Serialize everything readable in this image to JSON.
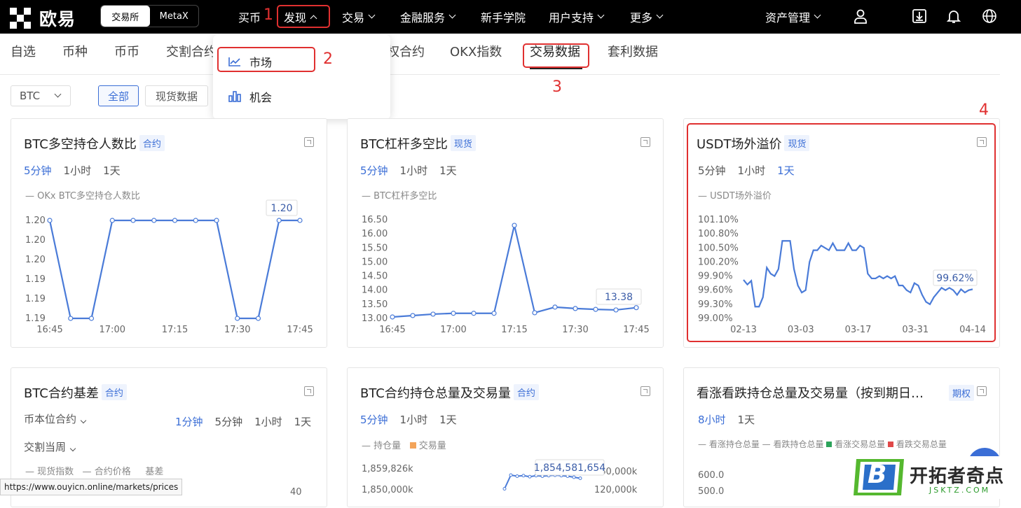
{
  "topbar": {
    "logo_text": "欧易",
    "seg": [
      "交易所",
      "MetaX"
    ],
    "nav": [
      "买币",
      "发现",
      "交易",
      "金融服务",
      "新手学院",
      "用户支持",
      "更多"
    ],
    "asset_mgmt": "资产管理"
  },
  "annotations": [
    "1",
    "2",
    "3",
    "4"
  ],
  "subnav": [
    "自选",
    "币种",
    "币币",
    "交割合约",
    "权合约",
    "OKX指数",
    "交易数据",
    "套利数据"
  ],
  "dropdown": {
    "items": [
      "市场",
      "机会"
    ]
  },
  "filter": {
    "coin": "BTC",
    "all": "全部",
    "spot": "现货数据"
  },
  "cards": [
    {
      "title": "BTC多空持仓人数比",
      "tag": "合约",
      "tabs": [
        "5分钟",
        "1小时",
        "1天"
      ],
      "legend": "OKx BTC多空持仓人数比"
    },
    {
      "title": "BTC杠杆多空比",
      "tag": "现货",
      "tabs": [
        "5分钟",
        "1小时",
        "1天"
      ],
      "legend": "BTC杠杆多空比"
    },
    {
      "title": "USDT场外溢价",
      "tag": "现货",
      "tabs": [
        "5分钟",
        "1小时",
        "1天"
      ],
      "legend": "USDT场外溢价"
    },
    {
      "title": "BTC合约基差",
      "tag": "合约",
      "selects": [
        "币本位合约",
        "交割当周"
      ],
      "tabs": [
        "1分钟",
        "5分钟",
        "1小时",
        "1天"
      ],
      "legend": [
        "现货指数",
        "合约价格",
        "基差"
      ],
      "axis_value": "40"
    },
    {
      "title": "BTC合约持仓总量及交易量",
      "tag": "合约",
      "tabs": [
        "5分钟",
        "1小时",
        "1天"
      ],
      "legend": [
        "持仓量",
        "交易量"
      ]
    },
    {
      "title": "看涨看跌持仓总量及交易量（按到期日…",
      "tag": "期权",
      "tabs": [
        "8小时",
        "1天"
      ],
      "legend": [
        "看涨持仓总量",
        "看跌持仓总量",
        "看涨交易总量",
        "看跌交易总量"
      ]
    }
  ],
  "chart_data": [
    {
      "type": "line",
      "series": [
        {
          "name": "OKx BTC多空持仓人数比",
          "values": [
            1.2,
            1.19,
            1.19,
            1.2,
            1.2,
            1.2,
            1.2,
            1.2,
            1.2,
            1.19,
            1.19,
            1.2,
            1.2
          ]
        }
      ],
      "x_ticks": [
        "16:45",
        "17:00",
        "17:15",
        "17:30",
        "17:45"
      ],
      "y_ticks": [
        "1.20",
        "1.20",
        "1.20",
        "1.19",
        "1.19",
        "1.19"
      ],
      "tooltip": "1.20",
      "norm": [
        0.0,
        1.0,
        1.0,
        0.0,
        0.0,
        0.0,
        0.0,
        0.0,
        0.0,
        1.0,
        1.0,
        0.0,
        0.0
      ]
    },
    {
      "type": "line",
      "series": [
        {
          "name": "BTC杠杆多空比",
          "values": [
            13.05,
            13.1,
            13.15,
            13.18,
            13.18,
            13.18,
            16.3,
            13.2,
            13.4,
            13.35,
            13.32,
            13.3,
            13.38
          ]
        }
      ],
      "x_ticks": [
        "16:45",
        "17:00",
        "17:15",
        "17:30",
        "17:45"
      ],
      "y_ticks": [
        "16.50",
        "16.00",
        "15.50",
        "15.00",
        "14.50",
        "14.00",
        "13.50",
        "13.00"
      ],
      "ylim": [
        13.0,
        16.5
      ],
      "tooltip": "13.38"
    },
    {
      "type": "line",
      "series": [
        {
          "name": "USDT场外溢价",
          "values": [
            99.82,
            99.72,
            99.8,
            99.25,
            99.25,
            99.45,
            100.08,
            99.95,
            99.9,
            100.05,
            100.65,
            100.65,
            100.65,
            100.05,
            99.7,
            99.55,
            99.6,
            100.2,
            100.45,
            100.45,
            100.55,
            100.5,
            100.45,
            100.6,
            100.45,
            100.45,
            100.45,
            100.6,
            100.45,
            100.45,
            100.55,
            100.5,
            99.95,
            99.85,
            99.85,
            99.9,
            99.85,
            99.9,
            99.85,
            99.9,
            99.7,
            99.7,
            99.6,
            99.55,
            99.75,
            99.7,
            99.5,
            99.35,
            99.3,
            99.45,
            99.55,
            99.65,
            99.6,
            99.65,
            99.6,
            99.5,
            99.62,
            99.55,
            99.6,
            99.62
          ]
        }
      ],
      "x_ticks": [
        "02-13",
        "03-03",
        "03-17",
        "03-31",
        "04-14"
      ],
      "y_ticks": [
        "101.10%",
        "100.80%",
        "100.50%",
        "100.20%",
        "99.90%",
        "99.60%",
        "99.30%",
        "99.00%"
      ],
      "ylim": [
        99.0,
        101.1
      ],
      "tooltip": "99.62%"
    },
    {
      "type": "bar",
      "series": [
        {
          "name": "交易量",
          "values": []
        },
        {
          "name": "持仓量",
          "values": [
            1852000,
            1854600,
            1854400,
            1854500,
            1854300,
            1854500,
            1854400,
            1854500,
            1854581,
            1854500,
            1854400,
            1854200,
            1854000
          ]
        }
      ],
      "y_ticks": [
        "1,859,826k",
        "1,850,000k"
      ],
      "y2_ticks": [
        "160,000k",
        "120,000k"
      ],
      "tooltip": "1,854,581,654"
    },
    {
      "type": "bar",
      "y_ticks": [
        "600.0",
        "500.0"
      ]
    }
  ],
  "status_url": "https://www.ouyicn.online/markets/prices",
  "watermark": {
    "title": "开拓者奇点",
    "sub": "JSKTZ.COM",
    "letter": "B"
  }
}
